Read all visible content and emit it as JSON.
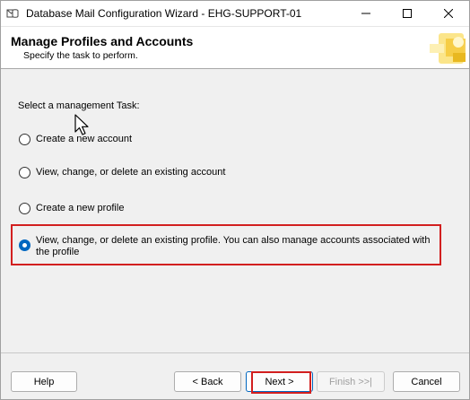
{
  "window": {
    "title": "Database Mail Configuration Wizard - EHG-SUPPORT-01",
    "icon": "database-mail-icon",
    "controls": [
      "minimize-icon",
      "maximize-icon",
      "close-icon"
    ]
  },
  "header": {
    "title": "Manage Profiles and Accounts",
    "subtitle": "Specify the task to perform."
  },
  "body": {
    "task_label": "Select a management Task:",
    "options": [
      {
        "label": "Create a new account",
        "selected": false
      },
      {
        "label": "View, change, or delete an existing account",
        "selected": false
      },
      {
        "label": "Create a new profile",
        "selected": false
      },
      {
        "label": "View, change, or delete an existing profile. You can also manage accounts associated with the profile",
        "selected": true
      }
    ]
  },
  "footer": {
    "help": "Help",
    "back": "< Back",
    "next": "Next >",
    "finish": "Finish >>|",
    "cancel": "Cancel"
  },
  "colors": {
    "highlight": "#d21f1f",
    "accent": "#0067c0"
  }
}
